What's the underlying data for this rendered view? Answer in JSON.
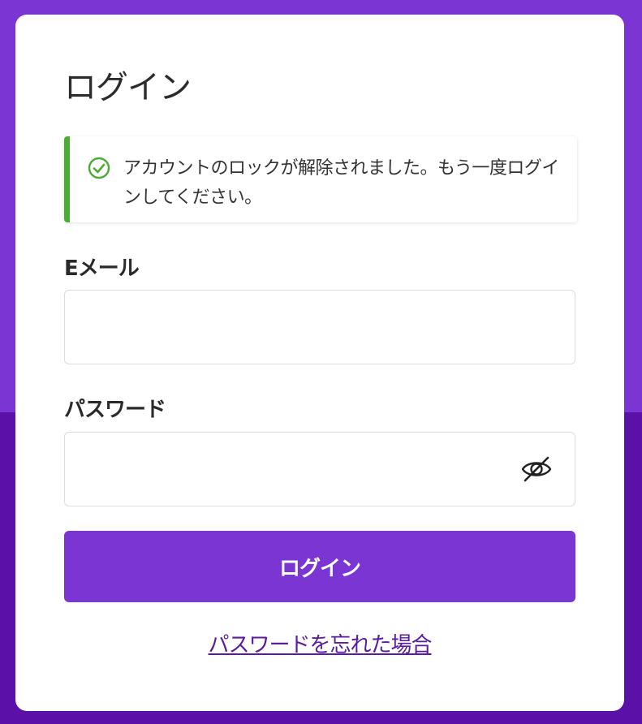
{
  "page": {
    "title": "ログイン"
  },
  "alert": {
    "icon": "check-circle-icon",
    "message": "アカウントのロックが解除されました。もう一度ログインしてください。",
    "accent_color": "#4aac32"
  },
  "form": {
    "email": {
      "label": "Eメール",
      "value": "",
      "placeholder": ""
    },
    "password": {
      "label": "パスワード",
      "value": "",
      "placeholder": "",
      "toggle_icon": "eye-off-icon"
    },
    "submit_label": "ログイン",
    "forgot_password_label": "パスワードを忘れた場合"
  },
  "colors": {
    "primary": "#7a35d2",
    "background_top": "#7a35d2",
    "background_bottom": "#5b11a8",
    "link": "#5a1b9e"
  }
}
